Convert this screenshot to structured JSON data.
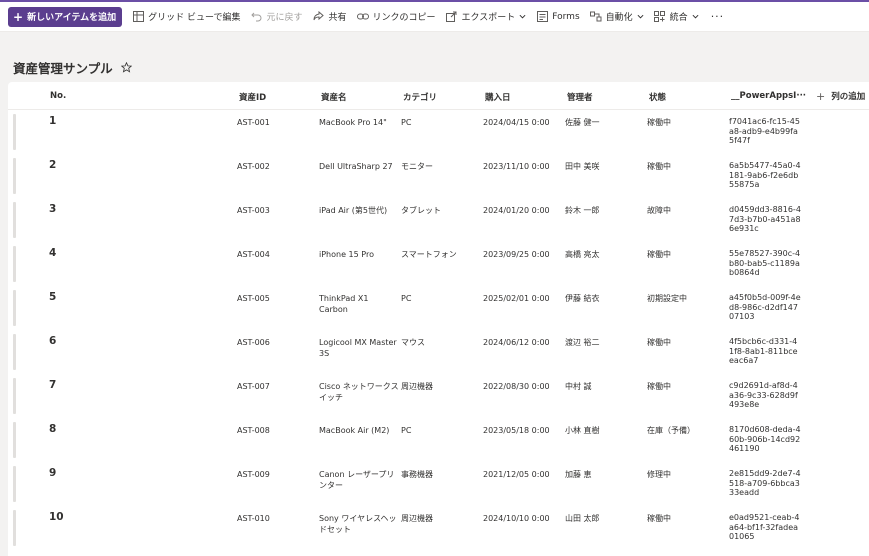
{
  "toolbar": {
    "new_item_label": "新しいアイテムを追加",
    "grid_view_label": "グリッド ビューで編集",
    "undo_label": "元に戻す",
    "share_label": "共有",
    "copy_link_label": "リンクのコピー",
    "export_label": "エクスポート",
    "forms_label": "Forms",
    "automate_label": "自動化",
    "integrate_label": "統合",
    "more_label": "···"
  },
  "list": {
    "title": "資産管理サンプル"
  },
  "columns": {
    "no": "No.",
    "asset_id": "資産ID",
    "asset_name": "資産名",
    "category": "カテゴリ",
    "purchase_date": "購入日",
    "manager": "管理者",
    "status": "状態",
    "powerapps": "__PowerAppsI···",
    "add_column": "列の追加"
  },
  "rows": [
    {
      "no": "1",
      "id": "AST-001",
      "name": "MacBook Pro 14\"",
      "category": "PC",
      "date": "2024/04/15 0:00",
      "manager": "佐藤 健一",
      "status": "稼働中",
      "guid": "f7041ac6-fc15-45a8-adb9-e4b99fa5f47f"
    },
    {
      "no": "2",
      "id": "AST-002",
      "name": "Dell UltraSharp 27",
      "category": "モニター",
      "date": "2023/11/10 0:00",
      "manager": "田中 美咲",
      "status": "稼働中",
      "guid": "6a5b5477-45a0-4181-9ab6-f2e6db55875a"
    },
    {
      "no": "3",
      "id": "AST-003",
      "name": "iPad Air (第5世代)",
      "category": "タブレット",
      "date": "2024/01/20 0:00",
      "manager": "鈴木 一郎",
      "status": "故障中",
      "guid": "d0459dd3-8816-47d3-b7b0-a451a86e931c"
    },
    {
      "no": "4",
      "id": "AST-004",
      "name": "iPhone 15 Pro",
      "category": "スマートフォン",
      "date": "2023/09/25 0:00",
      "manager": "高橋 亮太",
      "status": "稼働中",
      "guid": "55e78527-390c-4b80-bab5-c1189ab0864d"
    },
    {
      "no": "5",
      "id": "AST-005",
      "name": "ThinkPad X1 Carbon",
      "category": "PC",
      "date": "2025/02/01 0:00",
      "manager": "伊藤 結衣",
      "status": "初期設定中",
      "guid": "a45f0b5d-009f-4ed8-986c-d2df14707103"
    },
    {
      "no": "6",
      "id": "AST-006",
      "name": "Logicool MX Master 3S",
      "category": "マウス",
      "date": "2024/06/12 0:00",
      "manager": "渡辺 裕二",
      "status": "稼働中",
      "guid": "4f5bcb6c-d331-41f8-8ab1-811bceeac6a7"
    },
    {
      "no": "7",
      "id": "AST-007",
      "name": "Cisco ネットワークスイッチ",
      "category": "周辺機器",
      "date": "2022/08/30 0:00",
      "manager": "中村 誠",
      "status": "稼働中",
      "guid": "c9d2691d-af8d-4a36-9c33-628d9f493e8e"
    },
    {
      "no": "8",
      "id": "AST-008",
      "name": "MacBook Air (M2)",
      "category": "PC",
      "date": "2023/05/18 0:00",
      "manager": "小林 直樹",
      "status": "在庫（予備）",
      "guid": "8170d608-deda-460b-906b-14cd92461190"
    },
    {
      "no": "9",
      "id": "AST-009",
      "name": "Canon レーザープリンター",
      "category": "事務機器",
      "date": "2021/12/05 0:00",
      "manager": "加藤 恵",
      "status": "修理中",
      "guid": "2e815dd9-2de7-4518-a709-6bbca333eadd"
    },
    {
      "no": "10",
      "id": "AST-010",
      "name": "Sony ワイヤレスヘッドセット",
      "category": "周辺機器",
      "date": "2024/10/10 0:00",
      "manager": "山田 太郎",
      "status": "稼働中",
      "guid": "e0ad9521-ceab-4a64-bf1f-32fadea01065"
    }
  ]
}
